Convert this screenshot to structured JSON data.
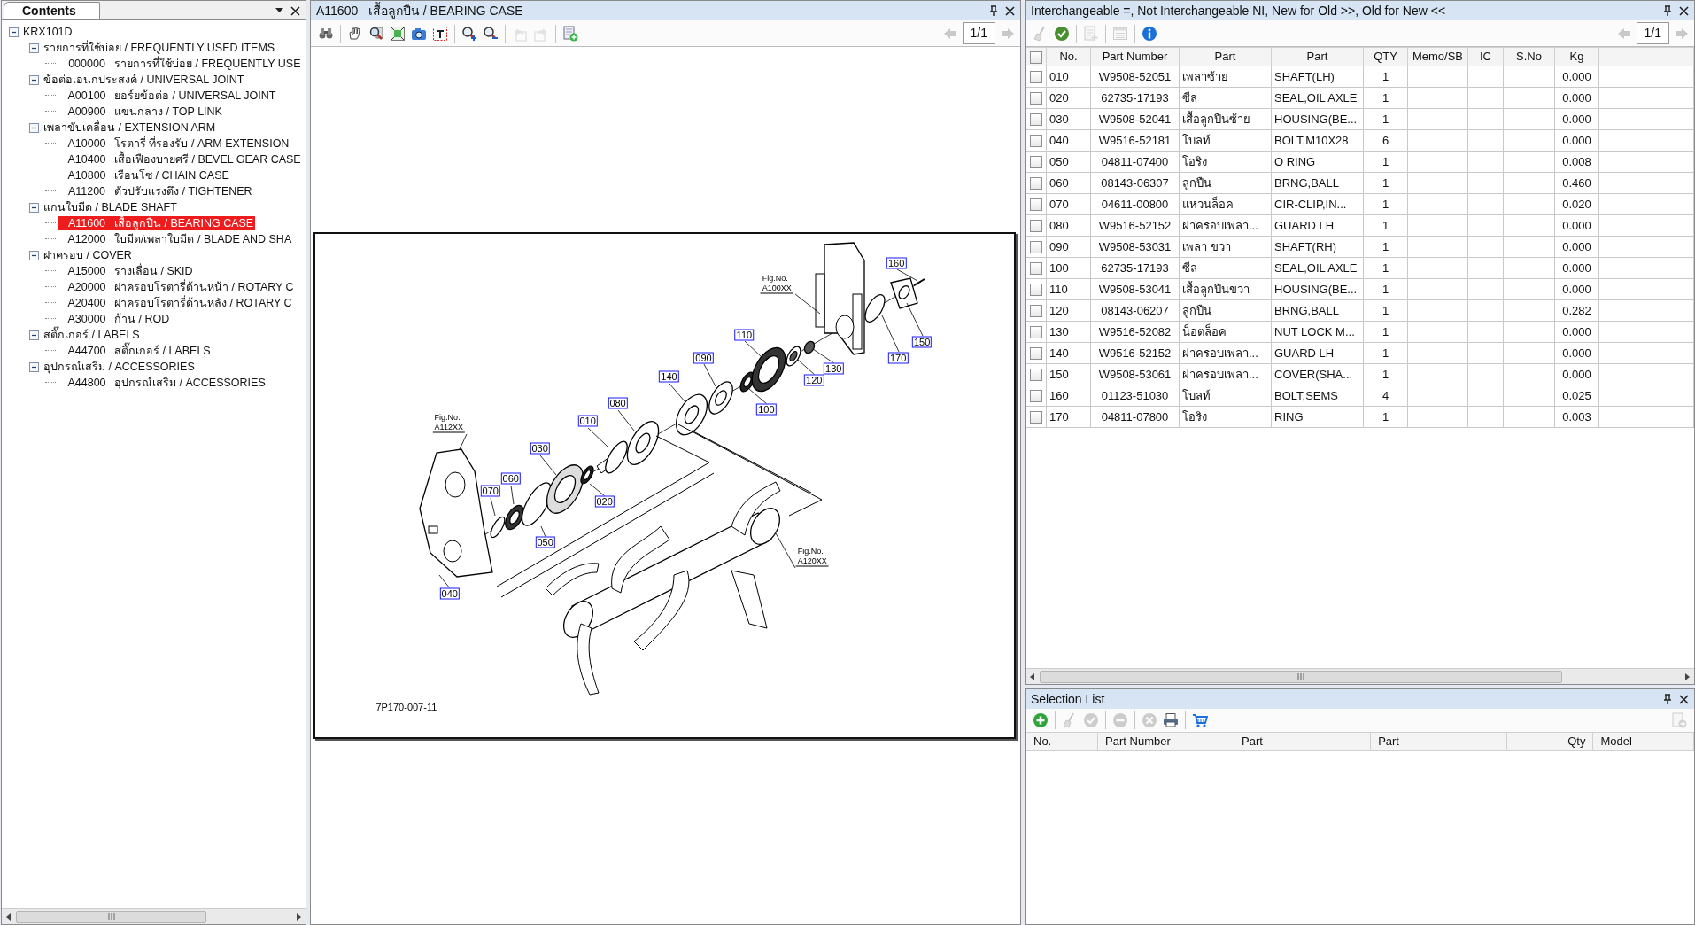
{
  "contents_panel": {
    "title": "Contents",
    "tree": [
      {
        "label": "KRX101D",
        "expanded": true,
        "children": [
          {
            "label": "รายการที่ใช้บ่อย / FREQUENTLY USED ITEMS",
            "expanded": true,
            "children": [
              {
                "code": "000000",
                "label": "รายการที่ใช้บ่อย / FREQUENTLY USE",
                "selected": false
              }
            ]
          },
          {
            "label": "ข้อต่อเอนกประสงค์ / UNIVERSAL JOINT",
            "expanded": true,
            "children": [
              {
                "code": "A00100",
                "label": "ยอร์ยข้อต่อ / UNIVERSAL JOINT",
                "selected": false
              },
              {
                "code": "A00900",
                "label": "แขนกลาง / TOP LINK",
                "selected": false
              }
            ]
          },
          {
            "label": "เพลาขับเคลื่อน / EXTENSION ARM",
            "expanded": true,
            "children": [
              {
                "code": "A10000",
                "label": "โรตารี่ ที่รองรับ / ARM EXTENSION",
                "selected": false
              },
              {
                "code": "A10400",
                "label": "เสื้อเฟืองบายศรี / BEVEL GEAR CASE",
                "selected": false
              },
              {
                "code": "A10800",
                "label": "เรือนโซ่ / CHAIN CASE",
                "selected": false
              },
              {
                "code": "A11200",
                "label": "ตัวปรับแรงตึง / TIGHTENER",
                "selected": false
              }
            ]
          },
          {
            "label": "แกนใบมีด / BLADE SHAFT",
            "expanded": true,
            "children": [
              {
                "code": "A11600",
                "label": "เสื้อลูกปืน / BEARING CASE",
                "selected": true
              },
              {
                "code": "A12000",
                "label": "ใบมีด/เพลาใบมีด / BLADE AND SHA",
                "selected": false
              }
            ]
          },
          {
            "label": "ฝาครอบ / COVER",
            "expanded": true,
            "children": [
              {
                "code": "A15000",
                "label": "รางเลื่อน / SKID",
                "selected": false
              },
              {
                "code": "A20000",
                "label": "ฝาครอบโรตารี่ด้านหน้า / ROTARY C",
                "selected": false
              },
              {
                "code": "A20400",
                "label": "ฝาครอบโรตารี่ด้านหลัง / ROTARY C",
                "selected": false
              },
              {
                "code": "A30000",
                "label": "ก้าน / ROD",
                "selected": false
              }
            ]
          },
          {
            "label": "สติ๊กเกอร์ / LABELS",
            "expanded": true,
            "children": [
              {
                "code": "A44700",
                "label": "สติ๊กเกอร์ / LABELS",
                "selected": false
              }
            ]
          },
          {
            "label": "อุปกรณ์เสริม / ACCESSORIES",
            "expanded": true,
            "children": [
              {
                "code": "A44800",
                "label": "อุปกรณ์เสริม / ACCESSORIES",
                "selected": false
              }
            ]
          }
        ]
      }
    ]
  },
  "drawing_panel": {
    "title": "A11600   เสื้อลูกปืน / BEARING CASE",
    "toolbar": [
      {
        "kind": "binoculars",
        "disabled": false
      },
      {
        "kind": "separator"
      },
      {
        "kind": "hand",
        "disabled": false
      },
      {
        "kind": "zoom-window",
        "disabled": false
      },
      {
        "kind": "fit",
        "disabled": false
      },
      {
        "kind": "camera",
        "disabled": false
      },
      {
        "kind": "text",
        "disabled": false
      },
      {
        "kind": "separator"
      },
      {
        "kind": "zoom-in",
        "disabled": false
      },
      {
        "kind": "zoom-out",
        "disabled": false
      },
      {
        "kind": "separator"
      },
      {
        "kind": "undo",
        "disabled": true
      },
      {
        "kind": "redo",
        "disabled": true
      },
      {
        "kind": "separator"
      },
      {
        "kind": "add-note",
        "disabled": false
      }
    ],
    "pager": {
      "text": "1/1",
      "prev_disabled": true,
      "next_disabled": true
    },
    "drawing": {
      "callouts": [
        "160",
        "110",
        "150",
        "170",
        "090",
        "130",
        "140",
        "120",
        "080",
        "100",
        "010",
        "030",
        "060",
        "070",
        "020",
        "050",
        "040"
      ],
      "figure_refs": [
        {
          "label": "Fig.No.",
          "code": "A100XX"
        },
        {
          "label": "Fig.No.",
          "code": "A112XX"
        },
        {
          "label": "Fig.No.",
          "code": "A120XX"
        }
      ],
      "drawing_number": "7P170-007-11"
    }
  },
  "parts_panel": {
    "title": "Interchangeable =, Not Interchangeable NI, New for Old >>, Old for New <<",
    "toolbar": [
      {
        "kind": "broom",
        "disabled": true
      },
      {
        "kind": "check",
        "disabled": false
      },
      {
        "kind": "separator"
      },
      {
        "kind": "add-list",
        "disabled": true
      },
      {
        "kind": "separator"
      },
      {
        "kind": "list",
        "disabled": true
      },
      {
        "kind": "separator"
      },
      {
        "kind": "info",
        "disabled": false
      }
    ],
    "pager": {
      "text": "1/1",
      "prev_disabled": true,
      "next_disabled": true
    },
    "table": {
      "all_checked": false,
      "columns": [
        "No.",
        "Part Number",
        "Part",
        "Part",
        "QTY",
        "Memo/SB",
        "IC",
        "S.No",
        "Kg"
      ],
      "rows": [
        {
          "checked": false,
          "no": "010",
          "part_number": "W9508-52051",
          "name_th": "เพลาซ้าย",
          "name_en": "SHAFT(LH)",
          "qty": "1",
          "kg": "0.000"
        },
        {
          "checked": false,
          "no": "020",
          "part_number": "62735-17193",
          "name_th": "ซีล",
          "name_en": "SEAL,OIL AXLE",
          "qty": "1",
          "kg": "0.000"
        },
        {
          "checked": false,
          "no": "030",
          "part_number": "W9508-52041",
          "name_th": "เสื้อลูกปืนซ้าย",
          "name_en": "HOUSING(BE...",
          "qty": "1",
          "kg": "0.000"
        },
        {
          "checked": false,
          "no": "040",
          "part_number": "W9516-52181",
          "name_th": "โบลท์",
          "name_en": "BOLT,M10X28",
          "qty": "6",
          "kg": "0.000"
        },
        {
          "checked": false,
          "no": "050",
          "part_number": "04811-07400",
          "name_th": "โอริง",
          "name_en": "O RING",
          "qty": "1",
          "kg": "0.008"
        },
        {
          "checked": false,
          "no": "060",
          "part_number": "08143-06307",
          "name_th": "ลูกปืน",
          "name_en": "BRNG,BALL",
          "qty": "1",
          "kg": "0.460"
        },
        {
          "checked": false,
          "no": "070",
          "part_number": "04611-00800",
          "name_th": "แหวนล็อค",
          "name_en": "CIR-CLIP,IN...",
          "qty": "1",
          "kg": "0.020"
        },
        {
          "checked": false,
          "no": "080",
          "part_number": "W9516-52152",
          "name_th": "ฝาครอบเพลา...",
          "name_en": "GUARD LH",
          "qty": "1",
          "kg": "0.000"
        },
        {
          "checked": false,
          "no": "090",
          "part_number": "W9508-53031",
          "name_th": "เพลา ขวา",
          "name_en": "SHAFT(RH)",
          "qty": "1",
          "kg": "0.000"
        },
        {
          "checked": false,
          "no": "100",
          "part_number": "62735-17193",
          "name_th": "ซีล",
          "name_en": "SEAL,OIL AXLE",
          "qty": "1",
          "kg": "0.000"
        },
        {
          "checked": false,
          "no": "110",
          "part_number": "W9508-53041",
          "name_th": "เสื้อลูกปืนขวา",
          "name_en": "HOUSING(BE...",
          "qty": "1",
          "kg": "0.000"
        },
        {
          "checked": false,
          "no": "120",
          "part_number": "08143-06207",
          "name_th": "ลูกปืน",
          "name_en": "BRNG,BALL",
          "qty": "1",
          "kg": "0.282"
        },
        {
          "checked": false,
          "no": "130",
          "part_number": "W9516-52082",
          "name_th": "น็อตล็อค",
          "name_en": "NUT LOCK M...",
          "qty": "1",
          "kg": "0.000"
        },
        {
          "checked": false,
          "no": "140",
          "part_number": "W9516-52152",
          "name_th": "ฝาครอบเพลา...",
          "name_en": "GUARD LH",
          "qty": "1",
          "kg": "0.000"
        },
        {
          "checked": false,
          "no": "150",
          "part_number": "W9508-53061",
          "name_th": "ฝาครอบเพลา...",
          "name_en": "COVER(SHA...",
          "qty": "1",
          "kg": "0.000"
        },
        {
          "checked": false,
          "no": "160",
          "part_number": "01123-51030",
          "name_th": "โบลท์",
          "name_en": "BOLT,SEMS",
          "qty": "4",
          "kg": "0.025"
        },
        {
          "checked": false,
          "no": "170",
          "part_number": "04811-07800",
          "name_th": "โอริง",
          "name_en": "RING",
          "qty": "1",
          "kg": "0.003"
        }
      ]
    }
  },
  "selection_panel": {
    "title": "Selection List",
    "toolbar": [
      {
        "kind": "add",
        "disabled": false
      },
      {
        "kind": "separator"
      },
      {
        "kind": "broom",
        "disabled": true
      },
      {
        "kind": "check",
        "disabled": true
      },
      {
        "kind": "separator"
      },
      {
        "kind": "minus",
        "disabled": true
      },
      {
        "kind": "separator"
      },
      {
        "kind": "delete",
        "disabled": true
      },
      {
        "kind": "printer",
        "disabled": false
      },
      {
        "kind": "separator"
      },
      {
        "kind": "cart",
        "disabled": false
      }
    ],
    "side_tools": [
      {
        "kind": "export",
        "disabled": true
      }
    ],
    "columns": [
      "No.",
      "Part Number",
      "Part",
      "Part",
      "Qty",
      "Model"
    ]
  }
}
